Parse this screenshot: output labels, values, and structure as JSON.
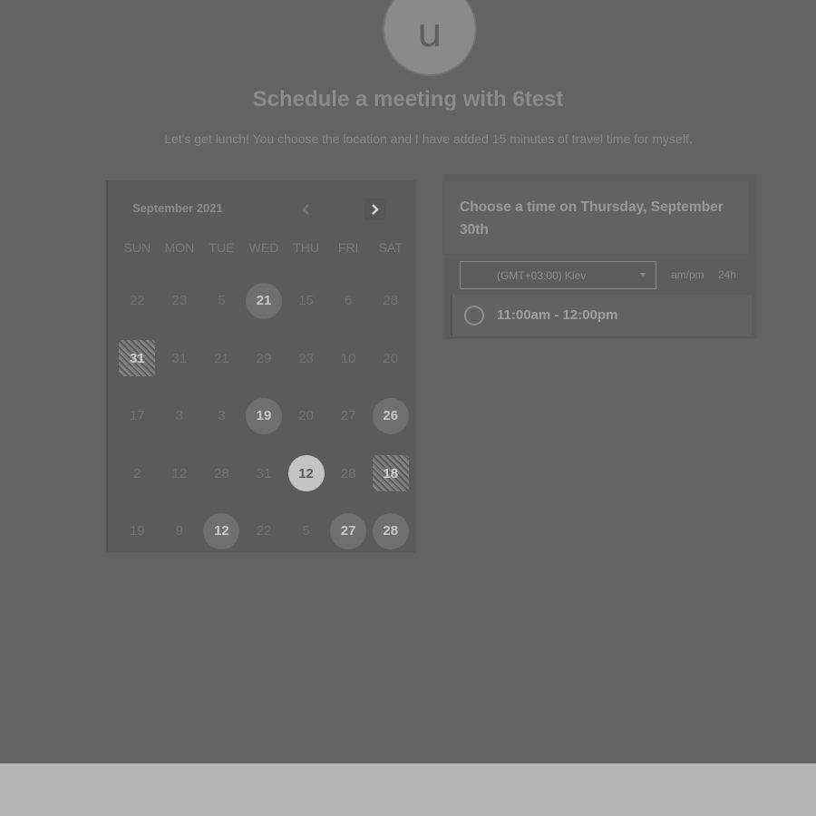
{
  "header": {
    "avatar_letter": "u",
    "title": "Schedule a meeting with 6test",
    "description": "Let's get lunch! You choose the location and I have added 15 minutes of travel time for myself."
  },
  "calendar": {
    "month_label": "September 2021",
    "prev_icon": "chevron-left-icon",
    "next_icon": "chevron-right-icon",
    "weekdays": [
      "SUN",
      "MON",
      "TUE",
      "WED",
      "THU",
      "FRI",
      "SAT"
    ],
    "days": [
      {
        "label": "22",
        "state": "default"
      },
      {
        "label": "23",
        "state": "default"
      },
      {
        "label": "5",
        "state": "default"
      },
      {
        "label": "21",
        "state": "available"
      },
      {
        "label": "15",
        "state": "default"
      },
      {
        "label": "6",
        "state": "default"
      },
      {
        "label": "28",
        "state": "default"
      },
      {
        "label": "31",
        "state": "noisy"
      },
      {
        "label": "31",
        "state": "default"
      },
      {
        "label": "21",
        "state": "default"
      },
      {
        "label": "29",
        "state": "default"
      },
      {
        "label": "23",
        "state": "default"
      },
      {
        "label": "10",
        "state": "default"
      },
      {
        "label": "20",
        "state": "default"
      },
      {
        "label": "17",
        "state": "default"
      },
      {
        "label": "3",
        "state": "default"
      },
      {
        "label": "3",
        "state": "default"
      },
      {
        "label": "19",
        "state": "available"
      },
      {
        "label": "20",
        "state": "default"
      },
      {
        "label": "27",
        "state": "default"
      },
      {
        "label": "26",
        "state": "available"
      },
      {
        "label": "2",
        "state": "default"
      },
      {
        "label": "12",
        "state": "default"
      },
      {
        "label": "28",
        "state": "default"
      },
      {
        "label": "31",
        "state": "default"
      },
      {
        "label": "12",
        "state": "selected"
      },
      {
        "label": "28",
        "state": "default"
      },
      {
        "label": "18",
        "state": "noisy"
      },
      {
        "label": "19",
        "state": "default"
      },
      {
        "label": "9",
        "state": "default"
      },
      {
        "label": "12",
        "state": "available"
      },
      {
        "label": "22",
        "state": "default"
      },
      {
        "label": "5",
        "state": "default"
      },
      {
        "label": "27",
        "state": "available"
      },
      {
        "label": "28",
        "state": "available"
      }
    ]
  },
  "time_panel": {
    "heading": "Choose a time on Thursday, September 30th",
    "timezone": "(GMT+03:00) Kiev",
    "format_ampm": "am/pm",
    "format_24h": "24h",
    "slots": [
      {
        "label": "11:00am - 12:00pm"
      }
    ]
  }
}
